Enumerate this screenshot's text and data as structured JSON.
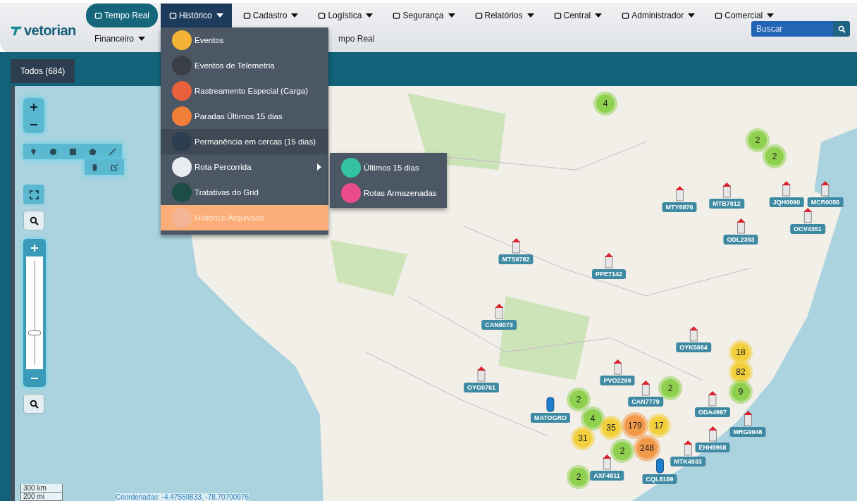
{
  "logo": {
    "text": "vetorian"
  },
  "nav": {
    "primary": [
      {
        "label": "Tempo Real",
        "current": true,
        "selected": false,
        "caret": false
      },
      {
        "label": "Histórico",
        "current": false,
        "selected": true,
        "caret": true
      },
      {
        "label": "Cadastro",
        "current": false,
        "selected": false,
        "caret": true
      },
      {
        "label": "Logística",
        "current": false,
        "selected": false,
        "caret": true
      },
      {
        "label": "Segurança",
        "current": false,
        "selected": false,
        "caret": true
      },
      {
        "label": "Relatórios",
        "current": false,
        "selected": false,
        "caret": true
      },
      {
        "label": "Central",
        "current": false,
        "selected": false,
        "caret": true
      },
      {
        "label": "Administrador",
        "current": false,
        "selected": false,
        "caret": true
      },
      {
        "label": "Comercial",
        "current": false,
        "selected": false,
        "caret": true
      }
    ],
    "secondary": [
      {
        "label": "Financeiro",
        "caret": true
      },
      {
        "label": "mpo Real",
        "caret": false
      }
    ]
  },
  "search": {
    "placeholder": "Buscar"
  },
  "dropdown": {
    "items": [
      {
        "label": "Eventos",
        "hovered": false,
        "selected": false,
        "submenu": false
      },
      {
        "label": "Eventos de Telemetria",
        "hovered": false,
        "selected": false,
        "submenu": false
      },
      {
        "label": "Rastreamento Especial (Carga)",
        "hovered": false,
        "selected": false,
        "submenu": false
      },
      {
        "label": "Paradas Últimos 15 dias",
        "hovered": false,
        "selected": false,
        "submenu": false
      },
      {
        "label": "Permanência em cercas (15 dias)",
        "hovered": true,
        "selected": false,
        "submenu": false
      },
      {
        "label": "Rota Percorrida",
        "hovered": false,
        "selected": false,
        "submenu": true
      },
      {
        "label": "Tratativas do Grid",
        "hovered": false,
        "selected": false,
        "submenu": false
      },
      {
        "label": "Histórico Arquivado",
        "hovered": false,
        "selected": true,
        "submenu": false
      }
    ],
    "submenu": [
      {
        "label": "Últimos 15 dias"
      },
      {
        "label": "Rotas Armazenadas"
      }
    ]
  },
  "tabs": [
    {
      "label": "Todos (684)",
      "selected": true
    }
  ],
  "map": {
    "zoom_slider": {
      "level": 0.3
    },
    "scale": [
      "300 km",
      "200 mi"
    ],
    "coordinates": "Coordenadas: -4.47559833, -78.70700976",
    "clusters": [
      {
        "count": "4",
        "color": "#8fd14f"
      },
      {
        "count": "2",
        "color": "#8fd14f"
      },
      {
        "count": "2",
        "color": "#8fd14f"
      },
      {
        "count": "18",
        "color": "#f2cf3b"
      },
      {
        "count": "82",
        "color": "#f2cf3b"
      },
      {
        "count": "9",
        "color": "#8fd14f"
      },
      {
        "count": "2",
        "color": "#8fd14f"
      },
      {
        "count": "2",
        "color": "#8fd14f"
      },
      {
        "count": "4",
        "color": "#8fd14f"
      },
      {
        "count": "35",
        "color": "#f2cf3b"
      },
      {
        "count": "31",
        "color": "#f2cf3b"
      },
      {
        "count": "179",
        "color": "#f39a4a"
      },
      {
        "count": "17",
        "color": "#f2cf3b"
      },
      {
        "count": "248",
        "color": "#f39a4a"
      },
      {
        "count": "2",
        "color": "#8fd14f"
      },
      {
        "count": "2",
        "color": "#8fd14f"
      }
    ],
    "vehicles": [
      {
        "plate": "MTY6876",
        "kind": "truck"
      },
      {
        "plate": "MTB7912",
        "kind": "truck"
      },
      {
        "plate": "JQH0090",
        "kind": "truck"
      },
      {
        "plate": "MCR0056",
        "kind": "truck"
      },
      {
        "plate": "OCV4351",
        "kind": "truck"
      },
      {
        "plate": "ODL2393",
        "kind": "truck"
      },
      {
        "plate": "MTS9782",
        "kind": "truck"
      },
      {
        "plate": "PPE7142",
        "kind": "truck"
      },
      {
        "plate": "CAN9073",
        "kind": "truck"
      },
      {
        "plate": "OYK5664",
        "kind": "truck"
      },
      {
        "plate": "OYG0761",
        "kind": "truck"
      },
      {
        "plate": "PVO2269",
        "kind": "truck"
      },
      {
        "plate": "CAN7779",
        "kind": "truck"
      },
      {
        "plate": "MATOGRO",
        "kind": "car"
      },
      {
        "plate": "ODA4997",
        "kind": "truck"
      },
      {
        "plate": "MRG9948",
        "kind": "truck"
      },
      {
        "plate": "EHH8968",
        "kind": "truck"
      },
      {
        "plate": "MTK4933",
        "kind": "truck"
      },
      {
        "plate": "AXF4811",
        "kind": "truck"
      },
      {
        "plate": "CQL8189",
        "kind": "car"
      }
    ]
  }
}
